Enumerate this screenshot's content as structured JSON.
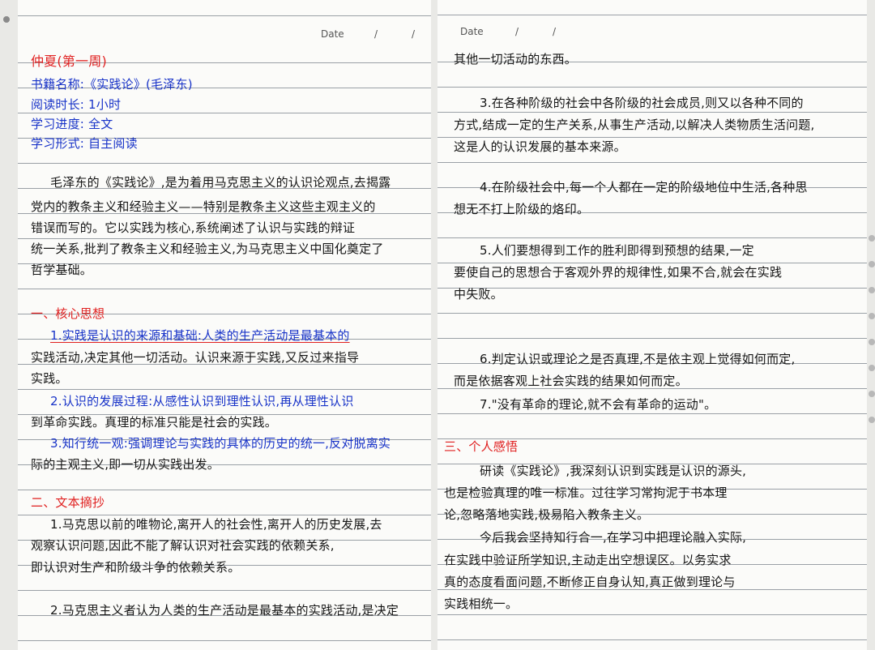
{
  "left": {
    "date_label": "Date",
    "date_slash1": "/",
    "date_slash2": "/",
    "header": {
      "title": "仲夏(第一周)",
      "book": "书籍名称:《实践论》(毛泽东)",
      "time": "阅读时长: 1小时",
      "progress": "学习进度: 全文",
      "form": "学习形式: 自主阅读"
    },
    "intro": [
      "毛泽东的《实践论》,是为着用马克思主义的认识论观点,去揭露",
      "党内的教条主义和经验主义——特别是教条主义这些主观主义的",
      "错误而写的。它以实践为核心,系统阐述了认识与实践的辩证",
      "统一关系,批判了教条主义和经验主义,为马克思主义中国化奠定了",
      "哲学基础。"
    ],
    "section1_title": "一、核心思想",
    "s1_lines": [
      "1.实践是认识的来源和基础:人类的生产活动是最基本的",
      "实践活动,决定其他一切活动。认识来源于实践,又反过来指导",
      "实践。"
    ],
    "s2_lines": [
      "2.认识的发展过程:从感性认识到理性认识,再从理性认识",
      "到革命实践。真理的标准只能是社会的实践。"
    ],
    "s3_lines": [
      "3.知行统一观:强调理论与实践的具体的历史的统一,反对脱离实",
      "际的主观主义,即一切从实践出发。"
    ],
    "section2_title": "二、文本摘抄",
    "e1_lines": [
      "1.马克思以前的唯物论,离开人的社会性,离开人的历史发展,去",
      "观察认识问题,因此不能了解认识对社会实践的依赖关系,",
      "即认识对生产和阶级斗争的依赖关系。"
    ],
    "e2_line": "2.马克思主义者认为人类的生产活动是最基本的实践活动,是决定"
  },
  "right": {
    "date_label": "Date",
    "date_slash1": "/",
    "date_slash2": "/",
    "cont_line": "其他一切活动的东西。",
    "e3_lines": [
      "3.在各种阶级的社会中各阶级的社会成员,则又以各种不同的",
      "方式,结成一定的生产关系,从事生产活动,以解决人类物质生活问题,",
      "这是人的认识发展的基本来源。"
    ],
    "e4_lines": [
      "4.在阶级社会中,每一个人都在一定的阶级地位中生活,各种思",
      "想无不打上阶级的烙印。"
    ],
    "e5_lines": [
      "5.人们要想得到工作的胜利即得到预想的结果,一定",
      "要使自己的思想合于客观外界的规律性,如果不合,就会在实践",
      "中失败。"
    ],
    "e6_lines": [
      "6.判定认识或理论之是否真理,不是依主观上觉得如何而定,",
      "而是依据客观上社会实践的结果如何而定。"
    ],
    "e7_line": "7.\"没有革命的理论,就不会有革命的运动\"。",
    "section3_title": "三、个人感悟",
    "r_lines": [
      "研读《实践论》,我深刻认识到实践是认识的源头,",
      "也是检验真理的唯一标准。过往学习常拘泥于书本理",
      "论,忽略落地实践,极易陷入教条主义。",
      "今后我会坚持知行合一,在学习中把理论融入实际,",
      "在实践中验证所学知识,主动走出空想误区。以务实求",
      "真的态度看面问题,不断修正自身认知,真正做到理论与",
      "实践相统一。"
    ]
  }
}
